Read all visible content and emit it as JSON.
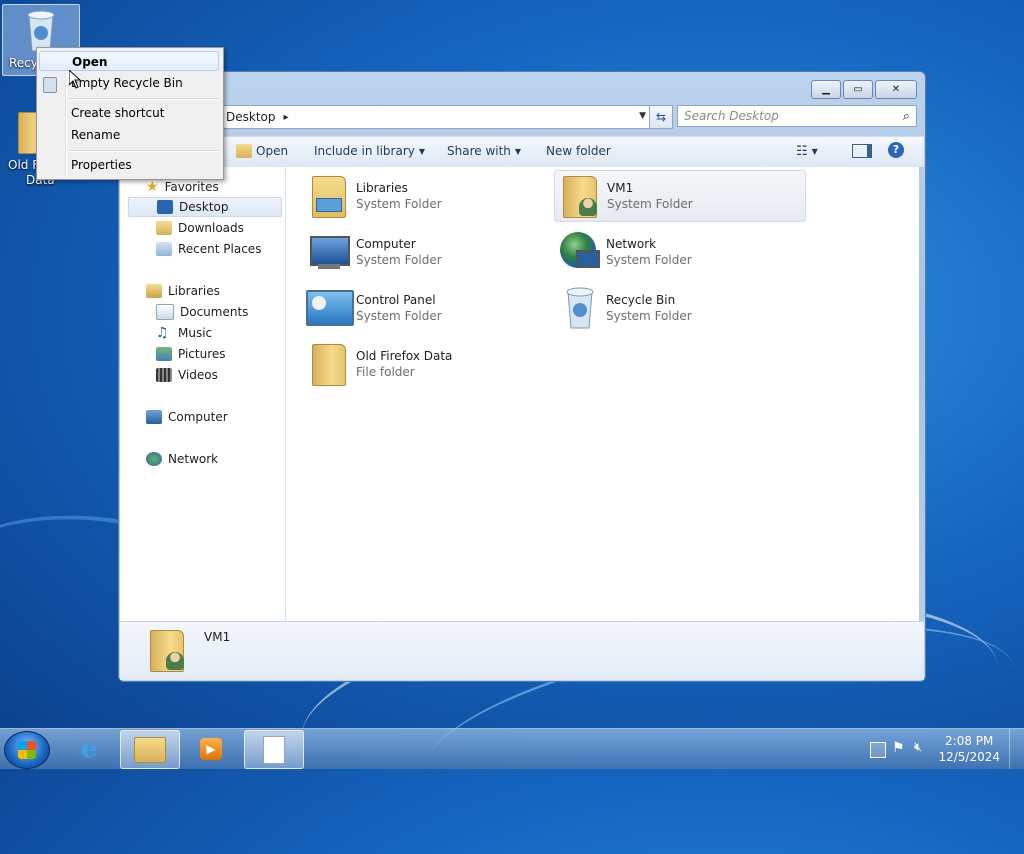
{
  "desktop": {
    "icons": [
      {
        "label": "Recycle Bin",
        "visible_label": "Recy",
        "selected": true
      },
      {
        "label": "Old Firefox Data",
        "visible_line1": "Old F",
        "visible_line2": "Data"
      }
    ]
  },
  "context_menu": {
    "items": [
      {
        "label": "Open",
        "highlighted": true
      },
      {
        "label": "Empty Recycle Bin"
      },
      {
        "label": "Create shortcut"
      },
      {
        "label": "Rename"
      },
      {
        "label": "Properties"
      }
    ]
  },
  "explorer": {
    "address": {
      "path": "Desktop",
      "separator": "▸"
    },
    "search_placeholder": "Search Desktop",
    "toolbar": {
      "open": "Open",
      "include_in_library": "Include in library",
      "share_with": "Share with",
      "new_folder": "New folder"
    },
    "nav": {
      "favorites": "Favorites",
      "desktop": "Desktop",
      "downloads": "Downloads",
      "recent_places": "Recent Places",
      "libraries": "Libraries",
      "documents": "Documents",
      "music": "Music",
      "pictures": "Pictures",
      "videos": "Videos",
      "computer": "Computer",
      "network": "Network"
    },
    "items": [
      {
        "name": "Libraries",
        "type": "System Folder"
      },
      {
        "name": "VM1",
        "type": "System Folder",
        "selected": true
      },
      {
        "name": "Computer",
        "type": "System Folder"
      },
      {
        "name": "Network",
        "type": "System Folder"
      },
      {
        "name": "Control Panel",
        "type": "System Folder"
      },
      {
        "name": "Recycle Bin",
        "type": "System Folder"
      },
      {
        "name": "Old Firefox Data",
        "type": "File folder"
      }
    ],
    "details": {
      "name": "VM1"
    }
  },
  "taskbar": {
    "clock": {
      "time": "2:08 PM",
      "date": "12/5/2024"
    }
  }
}
